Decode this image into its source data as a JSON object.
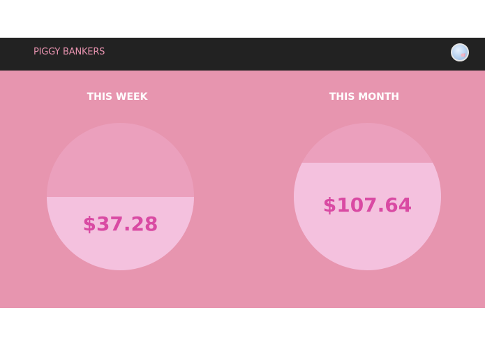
{
  "header": {
    "brand": "PIGGY BANKERS",
    "avatar_icon": "user-avatar-icon"
  },
  "colors": {
    "header_bg": "#222222",
    "brand_text": "#e893b0",
    "main_bg": "#e795af",
    "gauge_empty": "#eba0bd",
    "gauge_fill": "#f4c1de",
    "value_text": "#d94aa3"
  },
  "savings": [
    {
      "label": "THIS WEEK",
      "amount": "$37.28",
      "fill_fraction": 0.5
    },
    {
      "label": "THIS MONTH",
      "amount": "$107.64",
      "fill_fraction": 0.73
    }
  ]
}
